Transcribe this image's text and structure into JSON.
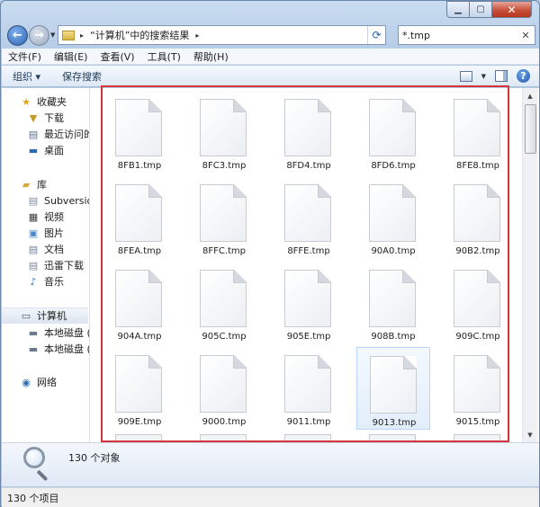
{
  "address": {
    "path_segment": "“计算机”中的搜索结果",
    "refresh_icon": "refresh-icon"
  },
  "search": {
    "value": "*.tmp"
  },
  "menubar": [
    "文件(F)",
    "编辑(E)",
    "查看(V)",
    "工具(T)",
    "帮助(H)"
  ],
  "toolbar": {
    "organize": "组织 ▾",
    "save_search": "保存搜索"
  },
  "navpane": {
    "favorites": "收藏夹",
    "downloads": "下载",
    "recent": "最近访问的",
    "desktop": "桌面",
    "libraries": "库",
    "subversion": "Subversion",
    "videos": "视频",
    "pictures": "图片",
    "documents": "文档",
    "xunlei": "迅雷下载",
    "music": "音乐",
    "computer": "计算机",
    "disk_c": "本地磁盘 (C",
    "disk_d": "本地磁盘 (D",
    "network": "网络"
  },
  "files": [
    "8FB1.tmp",
    "8FC3.tmp",
    "8FD4.tmp",
    "8FD6.tmp",
    "8FE8.tmp",
    "8FEA.tmp",
    "8FFC.tmp",
    "8FFE.tmp",
    "90A0.tmp",
    "90B2.tmp",
    "904A.tmp",
    "905C.tmp",
    "905E.tmp",
    "908B.tmp",
    "909C.tmp",
    "909E.tmp",
    "9000.tmp",
    "9011.tmp",
    "9013.tmp",
    "9015.tmp"
  ],
  "selected_file": "9013.tmp",
  "details": {
    "count": "130 个对象"
  },
  "status": {
    "text": "130 个项目"
  },
  "colors": {
    "highlight_box": "#d8323a",
    "selection": "#e3eefb"
  }
}
